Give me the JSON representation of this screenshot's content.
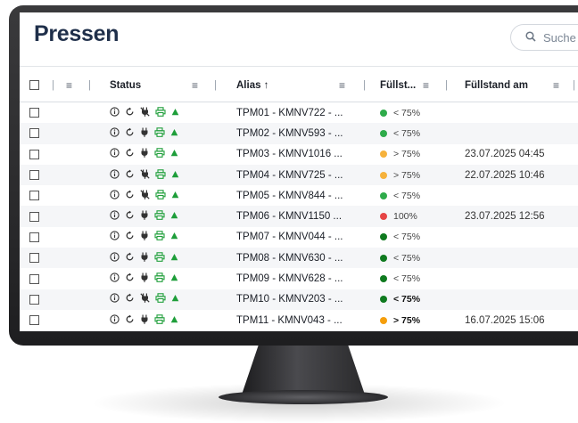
{
  "title": "Pressen",
  "search": {
    "placeholder": "Suche"
  },
  "columns": {
    "status": "Status",
    "alias": "Alias ↑",
    "fill": "Füllst...",
    "fill_date": "Füllstand am"
  },
  "colors": {
    "green": "#2eab4a",
    "yellow": "#f6b23c",
    "red": "#e64545",
    "dark_green": "#0f7a1f",
    "orange": "#f59e0b"
  },
  "rows": [
    {
      "alias": "TPM01 - KMNV722 - ...",
      "fill": "< 75%",
      "dot": "green",
      "date": "",
      "bold": false,
      "plug": "plug-off"
    },
    {
      "alias": "TPM02 - KMNV593 - ...",
      "fill": "< 75%",
      "dot": "green",
      "date": "",
      "bold": false,
      "plug": "plug"
    },
    {
      "alias": "TPM03 - KMNV1016 ...",
      "fill": "> 75%",
      "dot": "yellow",
      "date": "23.07.2025 04:45",
      "bold": false,
      "plug": "plug"
    },
    {
      "alias": "TPM04 - KMNV725 - ...",
      "fill": "> 75%",
      "dot": "yellow",
      "date": "22.07.2025 10:46",
      "bold": false,
      "plug": "plug-off"
    },
    {
      "alias": "TPM05 - KMNV844 - ...",
      "fill": "< 75%",
      "dot": "green",
      "date": "",
      "bold": false,
      "plug": "plug-off"
    },
    {
      "alias": "TPM06 - KMNV1150 ...",
      "fill": "100%",
      "dot": "red",
      "date": "23.07.2025 12:56",
      "bold": false,
      "plug": "plug"
    },
    {
      "alias": "TPM07 - KMNV044 - ...",
      "fill": "< 75%",
      "dot": "dark_green",
      "date": "",
      "bold": false,
      "plug": "plug"
    },
    {
      "alias": "TPM08 - KMNV630 - ...",
      "fill": "< 75%",
      "dot": "dark_green",
      "date": "",
      "bold": false,
      "plug": "plug"
    },
    {
      "alias": "TPM09 - KMNV628 - ...",
      "fill": "< 75%",
      "dot": "dark_green",
      "date": "",
      "bold": false,
      "plug": "plug"
    },
    {
      "alias": "TPM10 - KMNV203 - ...",
      "fill": "< 75%",
      "dot": "dark_green",
      "date": "",
      "bold": true,
      "plug": "plug-off"
    },
    {
      "alias": "TPM11 - KMNV043 - ...",
      "fill": "> 75%",
      "dot": "orange",
      "date": "16.07.2025 15:06",
      "bold": true,
      "plug": "plug"
    }
  ]
}
